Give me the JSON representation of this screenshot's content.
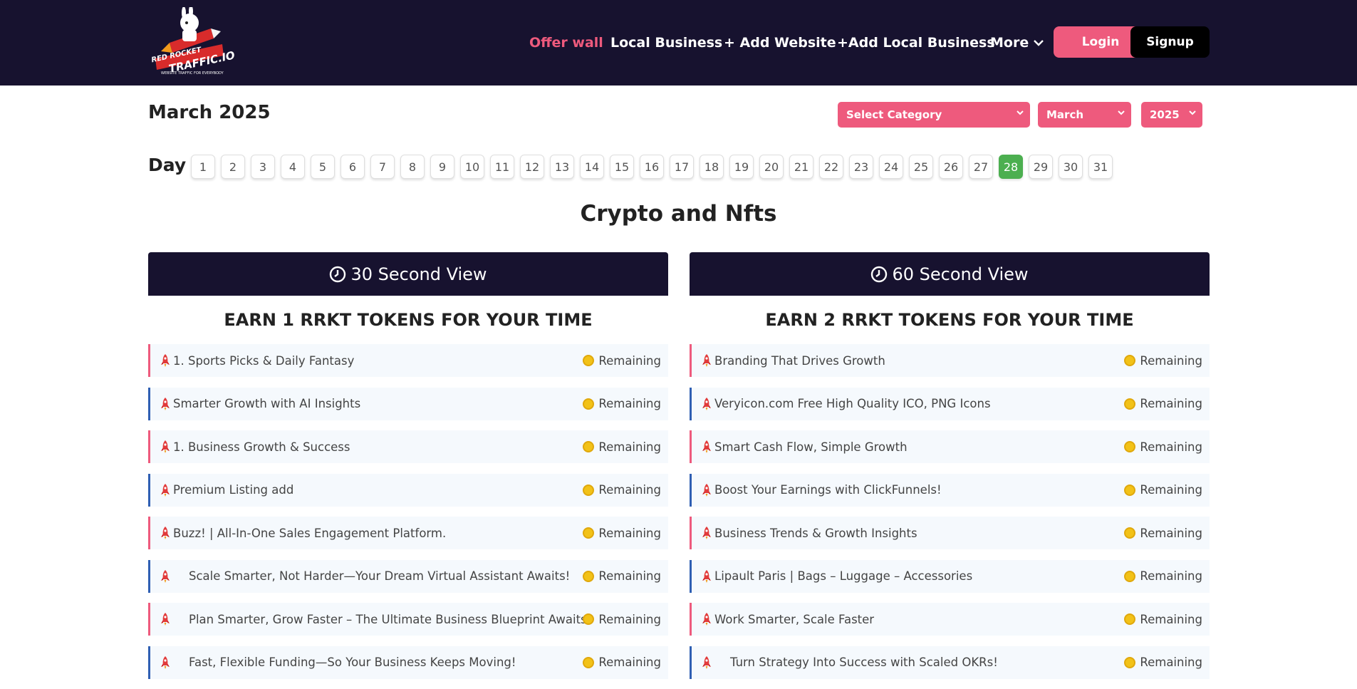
{
  "header": {
    "logo_top": "RED ROCKET",
    "logo_bottom": "TRAFFIC.IO",
    "logo_tagline": "WEBSITE TRAFFIC FOR EVERYBODY",
    "nav": {
      "offer_wall": "Offer wall",
      "local_business": "Local Business",
      "add_website": "+ Add Website",
      "add_local_business": "+Add Local Business",
      "more": "More"
    },
    "login": "Login",
    "signup": "Signup"
  },
  "month_title": "March 2025",
  "filters": {
    "category": "Select Category",
    "month": "March",
    "year": "2025"
  },
  "day_label": "Day",
  "days": [
    "1",
    "2",
    "3",
    "4",
    "5",
    "6",
    "7",
    "8",
    "9",
    "10",
    "11",
    "12",
    "13",
    "14",
    "15",
    "16",
    "17",
    "18",
    "19",
    "20",
    "21",
    "22",
    "23",
    "24",
    "25",
    "26",
    "27",
    "28",
    "29",
    "30",
    "31"
  ],
  "active_day": "28",
  "section_title": "Crypto and Nfts",
  "columns": [
    {
      "header": "30 Second View",
      "subheader": "EARN 1 RRKT TOKENS FOR YOUR TIME",
      "items": [
        {
          "title": "1. Sports Picks & Daily Fantasy",
          "status": "Remaining"
        },
        {
          "title": "Smarter Growth with AI Insights",
          "status": "Remaining"
        },
        {
          "title": "1. Business Growth & Success",
          "status": "Remaining"
        },
        {
          "title": "Premium Listing add",
          "status": "Remaining"
        },
        {
          "title": "Buzz! | All-In-One Sales Engagement Platform.",
          "status": "Remaining"
        },
        {
          "title": "Scale Smarter, Not Harder—Your Dream Virtual Assistant Awaits!",
          "status": "Remaining"
        },
        {
          "title": "Plan Smarter, Grow Faster – The Ultimate Business Blueprint Awaits!",
          "status": "Remaining"
        },
        {
          "title": "Fast, Flexible Funding—So Your Business Keeps Moving!",
          "status": "Remaining"
        }
      ]
    },
    {
      "header": "60 Second View",
      "subheader": "EARN 2 RRKT TOKENS FOR YOUR TIME",
      "items": [
        {
          "title": "Branding That Drives Growth",
          "status": "Remaining"
        },
        {
          "title": "Veryicon.com Free High Quality ICO, PNG Icons",
          "status": "Remaining"
        },
        {
          "title": "Smart Cash Flow, Simple Growth",
          "status": "Remaining"
        },
        {
          "title": "Boost Your Earnings with ClickFunnels!",
          "status": "Remaining"
        },
        {
          "title": "Business Trends & Growth Insights",
          "status": "Remaining"
        },
        {
          "title": "Lipault Paris | Bags – Luggage – Accessories",
          "status": "Remaining"
        },
        {
          "title": "Work Smarter, Scale Faster",
          "status": "Remaining"
        },
        {
          "title": "Turn Strategy Into Success with Scaled OKRs!",
          "status": "Remaining"
        }
      ]
    }
  ],
  "colors": {
    "navy": "#17122f",
    "accent_pink": "#ee5a7d",
    "active_green": "#4caf50",
    "row_blue_border": "#2f5fb3"
  }
}
